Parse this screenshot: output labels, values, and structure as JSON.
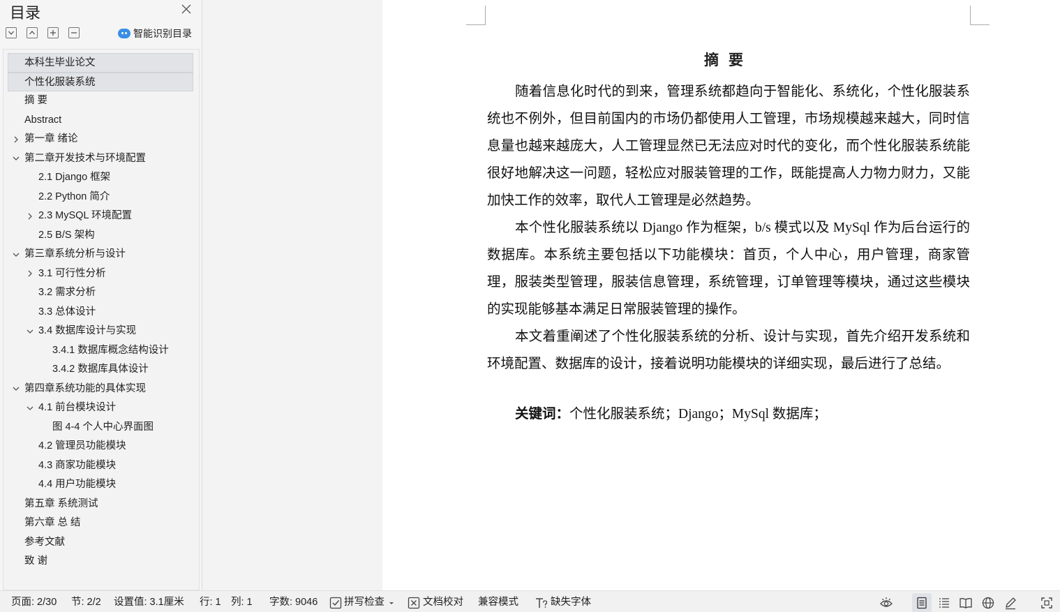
{
  "sidebar": {
    "title": "目录",
    "smart_toc_label": "智能识别目录",
    "items": [
      {
        "label": "本科生毕业论文",
        "level": 1,
        "selected": true,
        "chevron": ""
      },
      {
        "label": "个性化服装系统",
        "level": 1,
        "selected": true,
        "chevron": ""
      },
      {
        "label": "摘  要",
        "level": 1,
        "selected": false,
        "chevron": ""
      },
      {
        "label": "Abstract",
        "level": 1,
        "selected": false,
        "chevron": ""
      },
      {
        "label": "第一章  绪论",
        "level": 1,
        "selected": false,
        "chevron": "right"
      },
      {
        "label": "第二章开发技术与环境配置",
        "level": 1,
        "selected": false,
        "chevron": "down"
      },
      {
        "label": "2.1 Django 框架",
        "level": 2,
        "selected": false,
        "chevron": ""
      },
      {
        "label": "2.2 Python 简介",
        "level": 2,
        "selected": false,
        "chevron": ""
      },
      {
        "label": "2.3 MySQL 环境配置",
        "level": 2,
        "selected": false,
        "chevron": "right"
      },
      {
        "label": "2.5 B/S 架构",
        "level": 2,
        "selected": false,
        "chevron": ""
      },
      {
        "label": "第三章系统分析与设计",
        "level": 1,
        "selected": false,
        "chevron": "down"
      },
      {
        "label": "3.1 可行性分析",
        "level": 2,
        "selected": false,
        "chevron": "right"
      },
      {
        "label": "3.2  需求分析",
        "level": 2,
        "selected": false,
        "chevron": ""
      },
      {
        "label": "3.3 总体设计",
        "level": 2,
        "selected": false,
        "chevron": ""
      },
      {
        "label": "3.4  数据库设计与实现",
        "level": 2,
        "selected": false,
        "chevron": "down"
      },
      {
        "label": "3.4.1 数据库概念结构设计",
        "level": 3,
        "selected": false,
        "chevron": ""
      },
      {
        "label": "3.4.2 数据库具体设计",
        "level": 3,
        "selected": false,
        "chevron": ""
      },
      {
        "label": "第四章系统功能的具体实现",
        "level": 1,
        "selected": false,
        "chevron": "down"
      },
      {
        "label": "4.1 前台模块设计",
        "level": 2,
        "selected": false,
        "chevron": "down"
      },
      {
        "label": "图 4-4 个人中心界面图",
        "level": 3,
        "selected": false,
        "chevron": ""
      },
      {
        "label": "4.2 管理员功能模块",
        "level": 2,
        "selected": false,
        "chevron": ""
      },
      {
        "label": "4.3 商家功能模块",
        "level": 2,
        "selected": false,
        "chevron": ""
      },
      {
        "label": "4.4 用户功能模块",
        "level": 2,
        "selected": false,
        "chevron": ""
      },
      {
        "label": "第五章  系统测试",
        "level": 1,
        "selected": false,
        "chevron": ""
      },
      {
        "label": "第六章  总  结",
        "level": 1,
        "selected": false,
        "chevron": ""
      },
      {
        "label": "参考文献",
        "level": 1,
        "selected": false,
        "chevron": ""
      },
      {
        "label": "致  谢",
        "level": 1,
        "selected": false,
        "chevron": ""
      }
    ]
  },
  "document": {
    "heading": "摘要",
    "paragraphs": [
      "随着信息化时代的到来，管理系统都趋向于智能化、系统化，个性化服装系统也不例外，但目前国内的市场仍都使用人工管理，市场规模越来越大，同时信息量也越来越庞大，人工管理显然已无法应对时代的变化，而个性化服装系统能很好地解决这一问题，轻松应对服装管理的工作，既能提高人力物力财力，又能加快工作的效率，取代人工管理是必然趋势。",
      "本个性化服装系统以 Django 作为框架，b/s 模式以及 MySql 作为后台运行的数据库。本系统主要包括以下功能模块：首页，个人中心，用户管理，商家管理，服装类型管理，服装信息管理，系统管理，订单管理等模块，通过这些模块的实现能够基本满足日常服装管理的操作。",
      "本文着重阐述了个性化服装系统的分析、设计与实现，首先介绍开发系统和环境配置、数据库的设计，接着说明功能模块的详细实现，最后进行了总结。"
    ],
    "keywords_label": "关键词：",
    "keywords_text": "个性化服装系统；Django；MySql 数据库；"
  },
  "statusbar": {
    "page": "页面: 2/30",
    "section": "节: 2/2",
    "setting": "设置值: 3.1厘米",
    "row": "行: 1",
    "col": "列: 1",
    "word_count": "字数: 9046",
    "spell_check": "拼写检查",
    "proofread": "文档校对",
    "compat_mode": "兼容模式",
    "missing_fonts": "缺失字体"
  },
  "icons": [
    "close-icon",
    "collapse-all-icon",
    "expand-up-icon",
    "expand-icon",
    "minus-icon",
    "ai-bubble-icon",
    "chevron-right-icon",
    "chevron-down-icon",
    "check-box-icon",
    "dropdown-arrow-icon",
    "proofread-icon",
    "missing-font-icon",
    "eye-icon",
    "page-view-icon",
    "outline-view-icon",
    "reading-view-icon",
    "web-view-icon",
    "pen-icon",
    "fullscreen-icon"
  ],
  "colors": {
    "accent": "#3a8ee6",
    "selected_bg": "#e1e3e6"
  }
}
